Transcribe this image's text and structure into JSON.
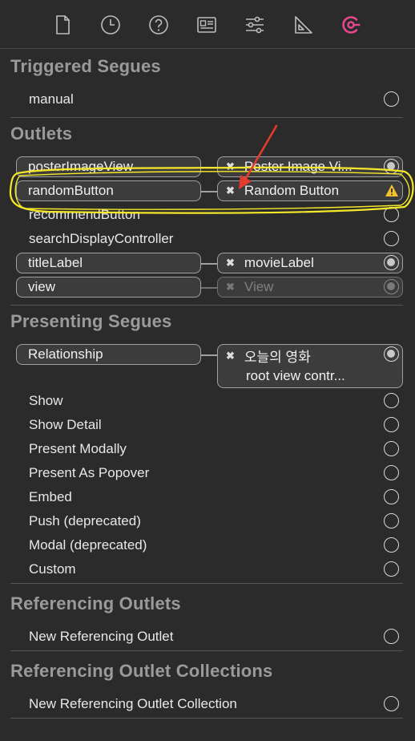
{
  "toolbar": {
    "icons": [
      "file-icon",
      "clock-icon",
      "help-icon",
      "identity-card-icon",
      "sliders-icon",
      "ruler-icon",
      "connections-icon"
    ],
    "active_color": "#e8478b"
  },
  "triggered_segues": {
    "title": "Triggered Segues",
    "rows": [
      {
        "label": "manual"
      }
    ]
  },
  "outlets": {
    "title": "Outlets",
    "rows": [
      {
        "label": "posterImageView",
        "target": "Poster Image Vi..."
      },
      {
        "label": "randomButton",
        "target": "Random Button"
      },
      {
        "label": "recommendButton"
      },
      {
        "label": "searchDisplayController"
      },
      {
        "label": "titleLabel",
        "target": "movieLabel"
      },
      {
        "label": "view",
        "target": "View"
      }
    ]
  },
  "presenting_segues": {
    "title": "Presenting Segues",
    "relationship": {
      "label": "Relationship",
      "target_line1": "오늘의 영화",
      "target_line2": "root view contr..."
    },
    "rows": [
      {
        "label": "Show"
      },
      {
        "label": "Show Detail"
      },
      {
        "label": "Present Modally"
      },
      {
        "label": "Present As Popover"
      },
      {
        "label": "Embed"
      },
      {
        "label": "Push (deprecated)"
      },
      {
        "label": "Modal (deprecated)"
      },
      {
        "label": "Custom"
      }
    ]
  },
  "referencing_outlets": {
    "title": "Referencing Outlets",
    "rows": [
      {
        "label": "New Referencing Outlet"
      }
    ]
  },
  "referencing_outlet_collections": {
    "title": "Referencing Outlet Collections",
    "rows": [
      {
        "label": "New Referencing Outlet Collection"
      }
    ]
  },
  "colors": {
    "annotation_highlight": "#f5e82a",
    "annotation_arrow": "#e53a2e",
    "warning": "#f2c230"
  }
}
